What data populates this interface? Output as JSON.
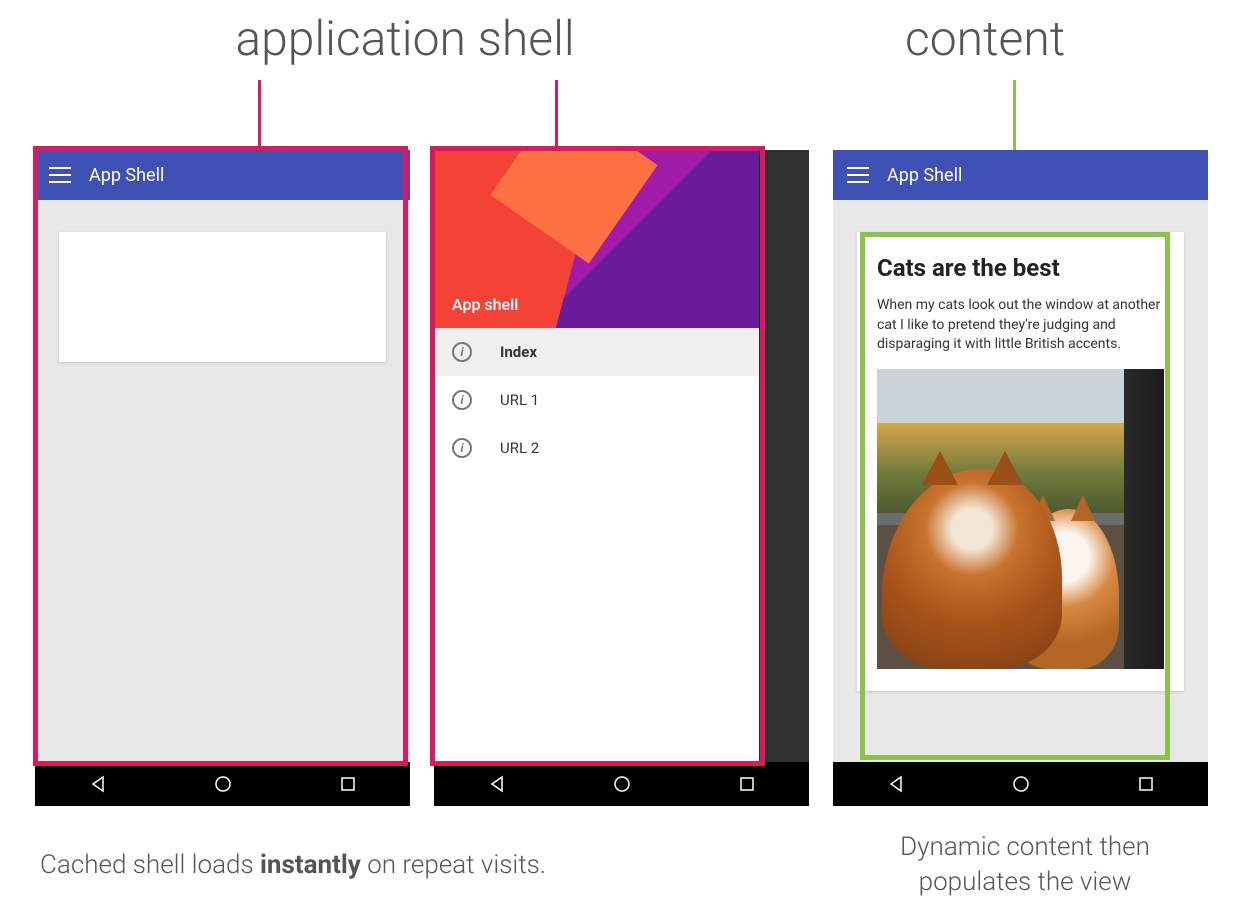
{
  "titles": {
    "left": "application shell",
    "right": "content"
  },
  "appbar_title": "App Shell",
  "drawer": {
    "header_title": "App shell",
    "items": [
      {
        "label": "Index",
        "selected": true
      },
      {
        "label": "URL 1",
        "selected": false
      },
      {
        "label": "URL 2",
        "selected": false
      }
    ]
  },
  "content": {
    "heading": "Cats are the best",
    "body": "When my cats look out the window at another cat I like to pretend they're judging and disparaging it with little British accents."
  },
  "captions": {
    "left_pre": "Cached shell loads ",
    "left_bold": "instantly",
    "left_post": " on repeat visits.",
    "right": "Dynamic content then populates the view"
  },
  "colors": {
    "appbar": "#3f51b5",
    "highlight_pink": "#d81b60",
    "highlight_green": "#8bc34a"
  }
}
